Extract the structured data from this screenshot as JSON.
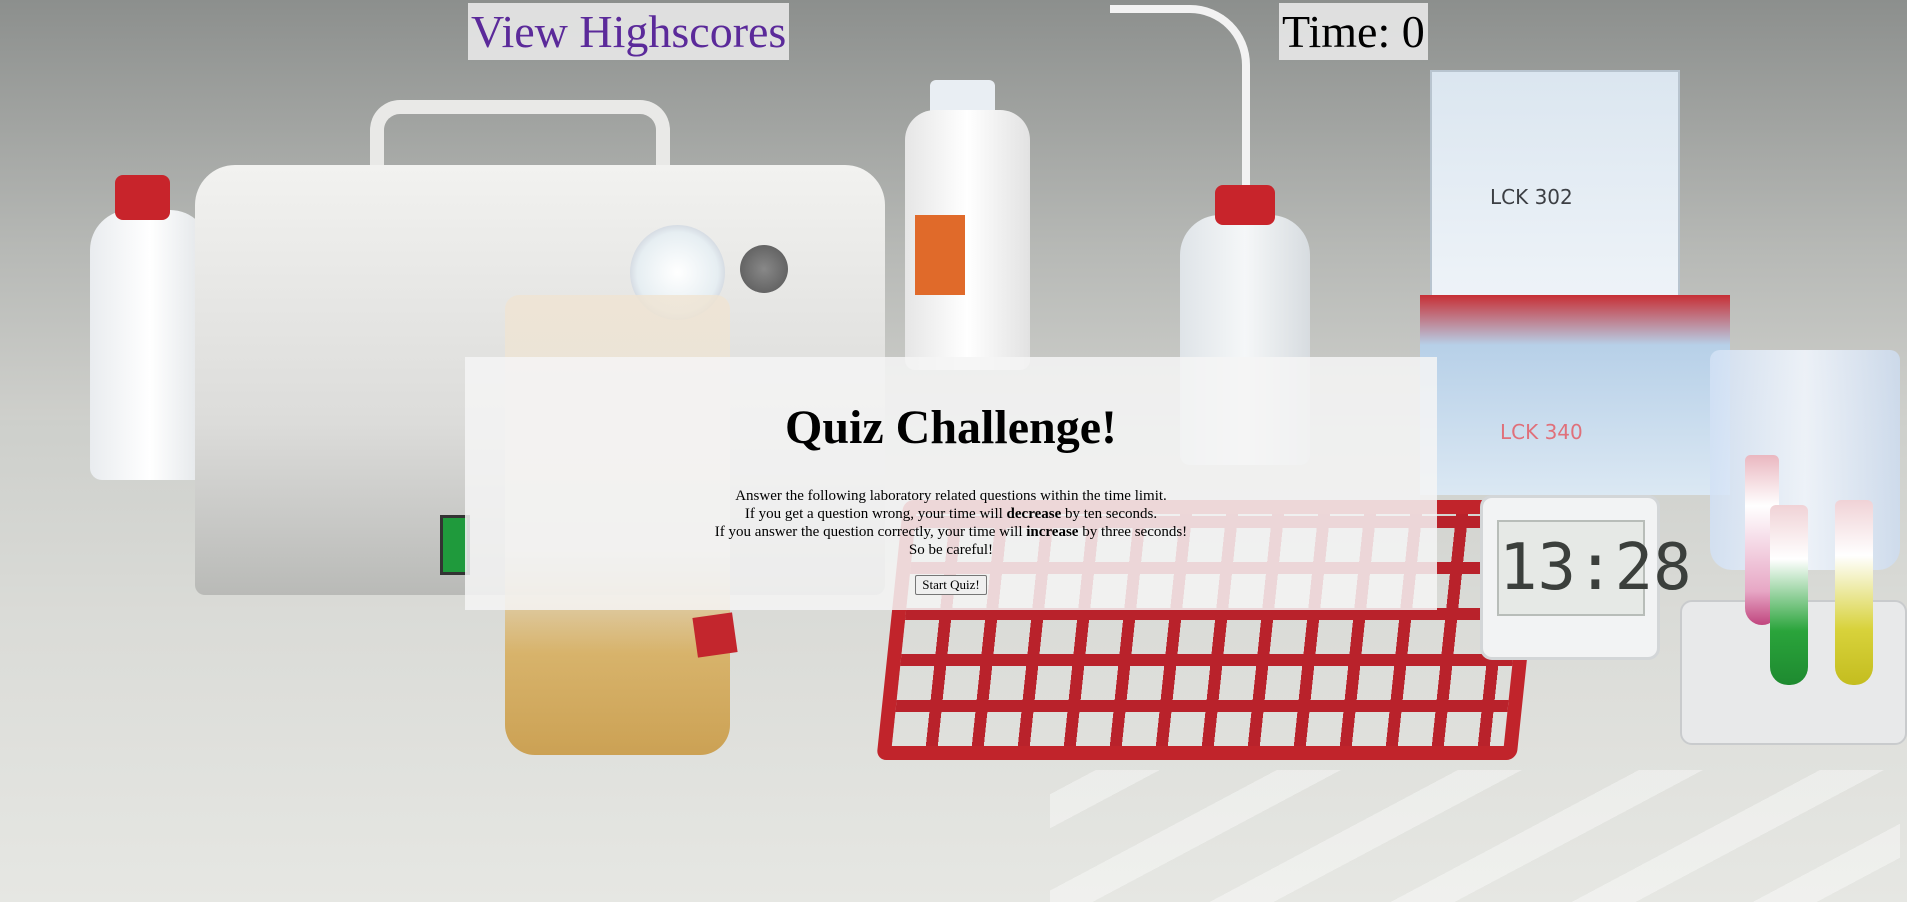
{
  "header": {
    "highscores_link": "View Highscores",
    "timer_label": "Time:",
    "timer_value": "0"
  },
  "quiz": {
    "title": "Quiz Challenge!",
    "instructions": [
      {
        "pre": "Answer the following laboratory related questions within the time limit.",
        "bold": "",
        "post": ""
      },
      {
        "pre": "If you get a question wrong, your time will ",
        "bold": "decrease",
        "post": " by ten seconds."
      },
      {
        "pre": "If you answer the question correctly, your time will ",
        "bold": "increase",
        "post": " by three seconds!"
      },
      {
        "pre": "So be careful!",
        "bold": "",
        "post": ""
      }
    ],
    "start_button": "Start Quiz!"
  },
  "background": {
    "timer_readout": "13:28",
    "box_label_1": "LCK 302",
    "box_label_2": "LCK 340"
  },
  "colors": {
    "link": "#5b2a9a",
    "overlay": "#f5f5f5"
  }
}
